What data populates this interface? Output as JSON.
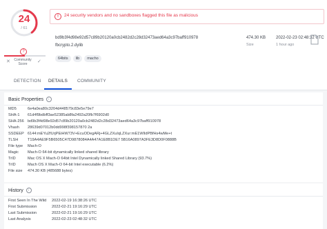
{
  "detection": {
    "positives": "24",
    "total": "/ 61",
    "ratio": 0.393,
    "alert": "24 security vendors and no sandboxes flagged this file as malicious"
  },
  "community": {
    "label": "Community Score",
    "negative_icon": "x-icon",
    "positive_icon": "check-icon",
    "level": 0.5
  },
  "file": {
    "hash": "bd9b3f4d98e92d57c89b20120a0cb2482d2c28d32473aed64a3c97baff910978",
    "name": "fbcrypto.2.dylib",
    "tags": [
      "64bits",
      "lib",
      "macho"
    ],
    "size": "474.30 KB",
    "size_label": "Size",
    "date": "2022-02-23 02:48:32 UTC",
    "date_label": "1 hour ago",
    "file_type_icon": "file-icon"
  },
  "tabs": [
    "DETECTION",
    "DETAILS",
    "COMMUNITY"
  ],
  "basic": {
    "title": "Basic Properties",
    "info_icon": "info-icon",
    "rows": [
      {
        "k": "MD5",
        "v": "6e4a0ea80c3204d448579c83e5e79e7"
      },
      {
        "k": "SHA-1",
        "v": "61d4f9bdbff3ae52385ab8fa2492a20fb7f6902d0"
      },
      {
        "k": "SHA-256",
        "v": "bd9b3f4d98e92d57c89b20120a0cb2482d2c28d32473aed64a3c97baff910978"
      },
      {
        "k": "Vhash",
        "v": "28639d07012b0dd998f398157870 2a"
      },
      {
        "k": "SSDEEP",
        "v": "6144:mEYu2fUrjPEiHW73V+EcuODegARj+4GLZXuIqLZXur:mE1WlIdPBfHs4wMe+t"
      },
      {
        "k": "TLSH",
        "v": "T19A4AE9F5B6505C47D9878084A4A47A1E8B1DE7 5B16A0897A3FE3D8D0F0888B"
      },
      {
        "k": "File type",
        "v": "Mach-O"
      },
      {
        "k": "Magic",
        "v": "Mach-O 64-bit dynamically linked shared library"
      },
      {
        "k": "TrID",
        "v": "Mac OS X Mach-O 64bit Intel Dynamically linked Shared Library (93.7%)"
      },
      {
        "k": "TrID",
        "v": "Mach OS X Mach-O 64-bit Intel executable (6.2%)"
      },
      {
        "k": "File size",
        "v": "474.30 KB (485688 bytes)"
      }
    ]
  },
  "history": {
    "title": "History",
    "info_icon": "info-icon",
    "rows": [
      {
        "k": "First Seen In The Wild",
        "v": "2022-02-19 16:38:26 UTC"
      },
      {
        "k": "First Submission",
        "v": "2022-02-21 19:16:29 UTC"
      },
      {
        "k": "Last Submission",
        "v": "2022-02-21 19:16:29 UTC"
      },
      {
        "k": "Last Analysis",
        "v": "2022-02-23 02:48:32 UTC"
      }
    ]
  },
  "colors": {
    "danger": "#e5394c",
    "accent": "#0b4dda"
  }
}
